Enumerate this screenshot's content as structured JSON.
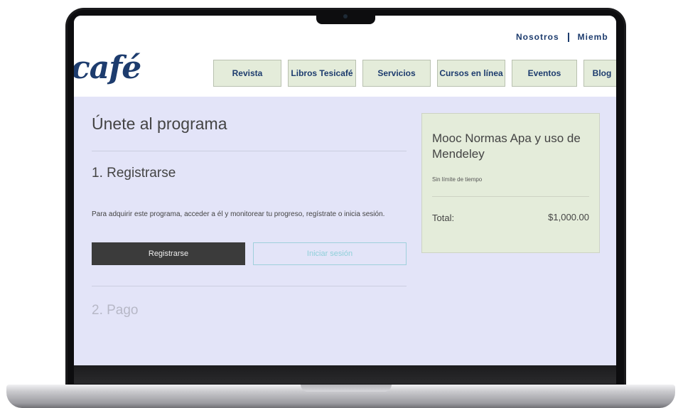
{
  "site": {
    "logo_text": "café",
    "top_links": [
      "Nosotros",
      "Miemb"
    ],
    "nav": [
      "Revista",
      "Libros Tesicafé",
      "Servicios",
      "Cursos en línea",
      "Eventos",
      "Blog"
    ]
  },
  "main": {
    "title": "Únete al programa",
    "step1": {
      "heading": "1. Registrarse",
      "description": "Para adquirir este programa, acceder a él y monitorear tu progreso, regístrate o inicia sesión.",
      "register_label": "Registrarse",
      "login_label": "Iniciar sesión"
    },
    "step2": {
      "heading": "2. Pago"
    }
  },
  "summary": {
    "course_title": "Mooc Normas Apa y uso de Mendeley",
    "duration": "Sin límite de tiempo",
    "total_label": "Total:",
    "total_value": "$1,000.00"
  },
  "colors": {
    "brand_navy": "#1d3c6e",
    "nav_bg": "#e4ecda",
    "content_bg": "#e3e4f8",
    "register_btn": "#3b3b3b",
    "login_btn_accent": "#8fcfd9"
  }
}
